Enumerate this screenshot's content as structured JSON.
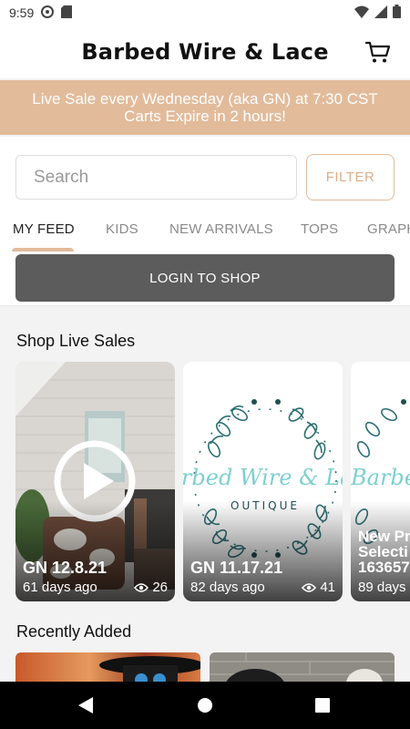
{
  "status_bar": {
    "time": "9:59"
  },
  "header": {
    "title": "Barbed Wire & Lace"
  },
  "banner": {
    "line1": "Live Sale every Wednesday (aka GN) at 7:30 CST",
    "line2": "Carts Expire in 2 hours!"
  },
  "search": {
    "placeholder": "Search",
    "value": ""
  },
  "filter": {
    "label": "FILTER"
  },
  "tabs": [
    "MY FEED",
    "KIDS",
    "NEW ARRIVALS",
    "TOPS",
    "GRAPH"
  ],
  "active_tab": "MY FEED",
  "login": {
    "label": "LOGIN TO SHOP"
  },
  "live_sales": {
    "title": "Shop Live Sales",
    "cards": [
      {
        "title": "GN 12.8.21",
        "ago": "61 days ago",
        "views": "26"
      },
      {
        "title": "GN 11.17.21",
        "ago": "82 days ago",
        "views": "41"
      },
      {
        "title_line1": "New Pr",
        "title_line2": "Selecti",
        "title_line3": "163657",
        "ago": "89 days"
      }
    ],
    "logo_text": "Barbed Wire & Lace",
    "logo_subtext": "OUTIQUE"
  },
  "recent": {
    "title": "Recently Added"
  },
  "colors": {
    "accent": "#e2bb9b",
    "login_button": "#5c5c5c",
    "teal": "#2e6f72"
  }
}
